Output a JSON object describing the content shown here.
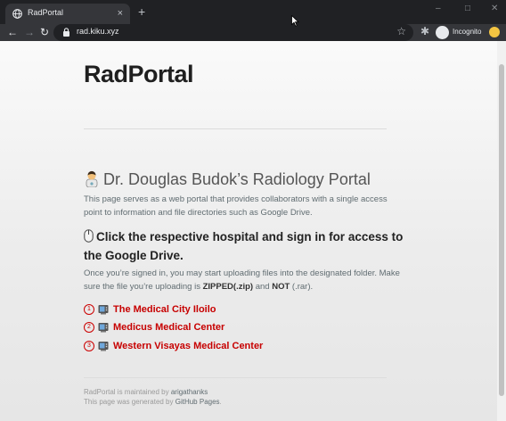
{
  "browser": {
    "tab_title": "RadPortal",
    "tab_close": "×",
    "new_tab": "+",
    "window_controls": {
      "minimize": "–",
      "maximize": "□",
      "close": "✕"
    },
    "url": "rad.kiku.xyz",
    "profile_label": "Incognito"
  },
  "page": {
    "site_title": "RadPortal",
    "heading": "Dr. Douglas Budok’s Radiology Portal",
    "intro": "This page serves as a web portal that provides collaborators with a single access point to information and file directories such as Google Drive.",
    "subheading": "Click the respective hospital and sign in for access to the Google Drive.",
    "instructions": {
      "before_bold1": "Once you’re signed in, you may start uploading files into the designated folder. Make sure the file you’re uploading is ",
      "bold1": "ZIPPED(.zip)",
      "between": " and ",
      "bold2": "NOT",
      "after": " (.rar)."
    },
    "hospitals": [
      {
        "number": "1",
        "name": "The Medical City Iloilo"
      },
      {
        "number": "2",
        "name": "Medicus Medical Center"
      },
      {
        "number": "3",
        "name": "Western Visayas Medical Center"
      }
    ],
    "footer": {
      "line1_prefix": "RadPortal is maintained by ",
      "maintainer": "arigathanks",
      "line2_prefix": "This page was generated by ",
      "generator": "GitHub Pages",
      "line2_suffix": "."
    }
  },
  "colors": {
    "link_red": "#c70000",
    "chrome_dark": "#202124",
    "chrome_toolbar": "#35363a",
    "text_body": "#606c71"
  }
}
